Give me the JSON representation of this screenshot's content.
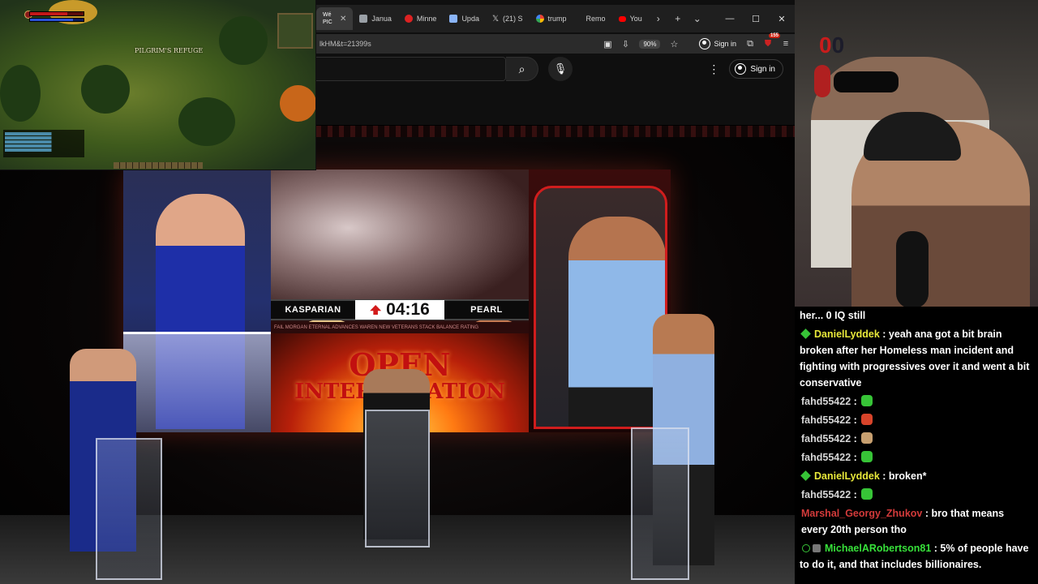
{
  "browser": {
    "tabs": [
      {
        "label": "Wé PIC",
        "active": true,
        "fav_color": "#5a5a5a"
      },
      {
        "label": "Janua",
        "fav_color": "#9aa0a6"
      },
      {
        "label": "Minne",
        "fav_color": "#d22"
      },
      {
        "label": "Upda",
        "fav_color": "#8ab4f8"
      },
      {
        "label": "(21) S",
        "fav_color": "#ffffff"
      },
      {
        "label": "trump",
        "fav_color": "#4285f4"
      },
      {
        "label": "Remo",
        "fav_color": "#ffffff"
      },
      {
        "label": "You",
        "fav_color": "#ff0000"
      }
    ],
    "url_fragment": "lkHM&t=21399s",
    "zoom": "90%",
    "signin_label": "Sign in",
    "notification_count": "155",
    "yt_signin_label": "Sign in"
  },
  "game": {
    "zone_name": "PILGRIM'S REFUGE",
    "hp_fraction": 0.7,
    "mp_fraction": 0.8
  },
  "scoreboard": {
    "left_name": "KASPARIAN",
    "timer": "04:16",
    "right_name": "PEARL",
    "ticker": "FAIL MORGAN ETERNAL ADVANCES WAREN NEW VETERANS STACK BALANCE RATING",
    "title_line1": "OPEN",
    "title_line2": "INTERROGATION"
  },
  "webcam": {
    "counter_left": "0",
    "counter_right": "0"
  },
  "chat": [
    {
      "user": "",
      "user_color": "#ffffff",
      "text": "her... 0 IQ still",
      "badge": "none"
    },
    {
      "user": "DanielLyddek",
      "user_color": "#e8e83a",
      "text": "yeah ana got a bit brain broken after her Homeless man incident and fighting with progressives over it and went a bit conservative",
      "badge": "diamond"
    },
    {
      "user": "fahd55422",
      "user_color": "#d6d6d6",
      "text": "",
      "badge": "none",
      "emote": "#37c437"
    },
    {
      "user": "fahd55422",
      "user_color": "#d6d6d6",
      "text": "",
      "badge": "none",
      "emote": "#d8442a"
    },
    {
      "user": "fahd55422",
      "user_color": "#d6d6d6",
      "text": "",
      "badge": "none",
      "emote": "#c8a070"
    },
    {
      "user": "fahd55422",
      "user_color": "#d6d6d6",
      "text": "",
      "badge": "none",
      "emote": "#37c437"
    },
    {
      "user": "DanielLyddek",
      "user_color": "#e8e83a",
      "text": "broken*",
      "badge": "diamond"
    },
    {
      "user": "fahd55422",
      "user_color": "#d6d6d6",
      "text": "",
      "badge": "none",
      "emote": "#37c437"
    },
    {
      "user": "Marshal_Georgy_Zhukov",
      "user_color": "#d23a3a",
      "text": "bro that means every 20th person tho",
      "badge": "none"
    },
    {
      "user": "MichaelARobertson81",
      "user_color": "#37e03a",
      "text": "5% of people have to do it, and that includes billionaires.",
      "badge": "sub"
    }
  ],
  "colors": {
    "accent_red": "#d01d1d",
    "chat_green": "#37c437"
  }
}
